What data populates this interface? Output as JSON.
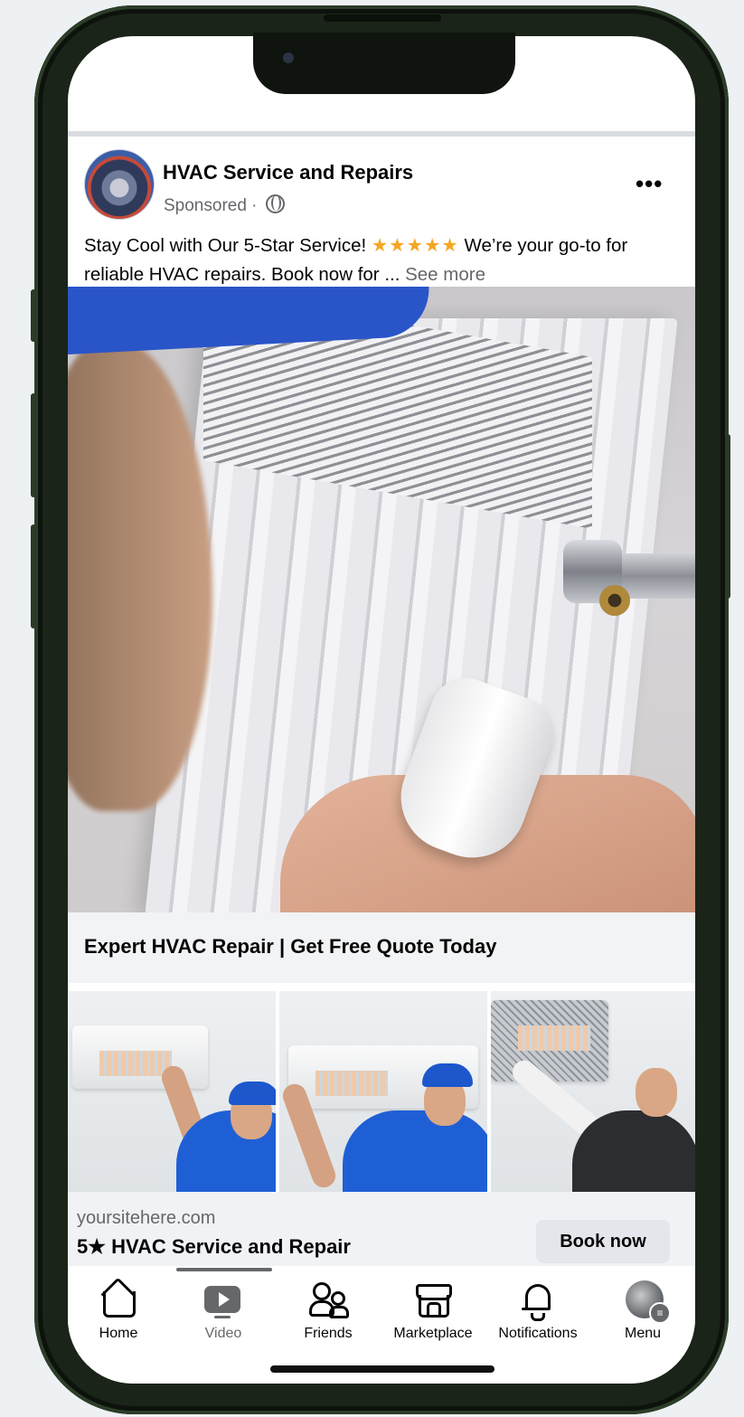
{
  "post": {
    "page_name": "HVAC Service and Repairs",
    "sponsored": "Sponsored ·",
    "caption_start": "Stay Cool with Our 5-Star Service! ",
    "caption_stars": "★★★★★",
    "caption_rest": " We’re your go-to for reliable HVAC repairs. Book now for ... ",
    "see_more": "See more",
    "more_icon": "•••"
  },
  "ad": {
    "headline": "Expert HVAC Repair | Get Free Quote Today",
    "site": "yoursitehere.com",
    "title": "5★ HVAC Service and Repair",
    "cta": "Book now"
  },
  "tabs": [
    {
      "label": "Home",
      "icon": "home-icon"
    },
    {
      "label": "Video",
      "icon": "video-icon"
    },
    {
      "label": "Friends",
      "icon": "friends-icon"
    },
    {
      "label": "Marketplace",
      "icon": "marketplace-icon"
    },
    {
      "label": "Notifications",
      "icon": "bell-icon"
    },
    {
      "label": "Menu",
      "icon": "menu-avatar"
    }
  ],
  "colors": {
    "accent_blue": "#1f5fd6",
    "star_orange": "#f5a623",
    "text_secondary": "#65676b"
  }
}
